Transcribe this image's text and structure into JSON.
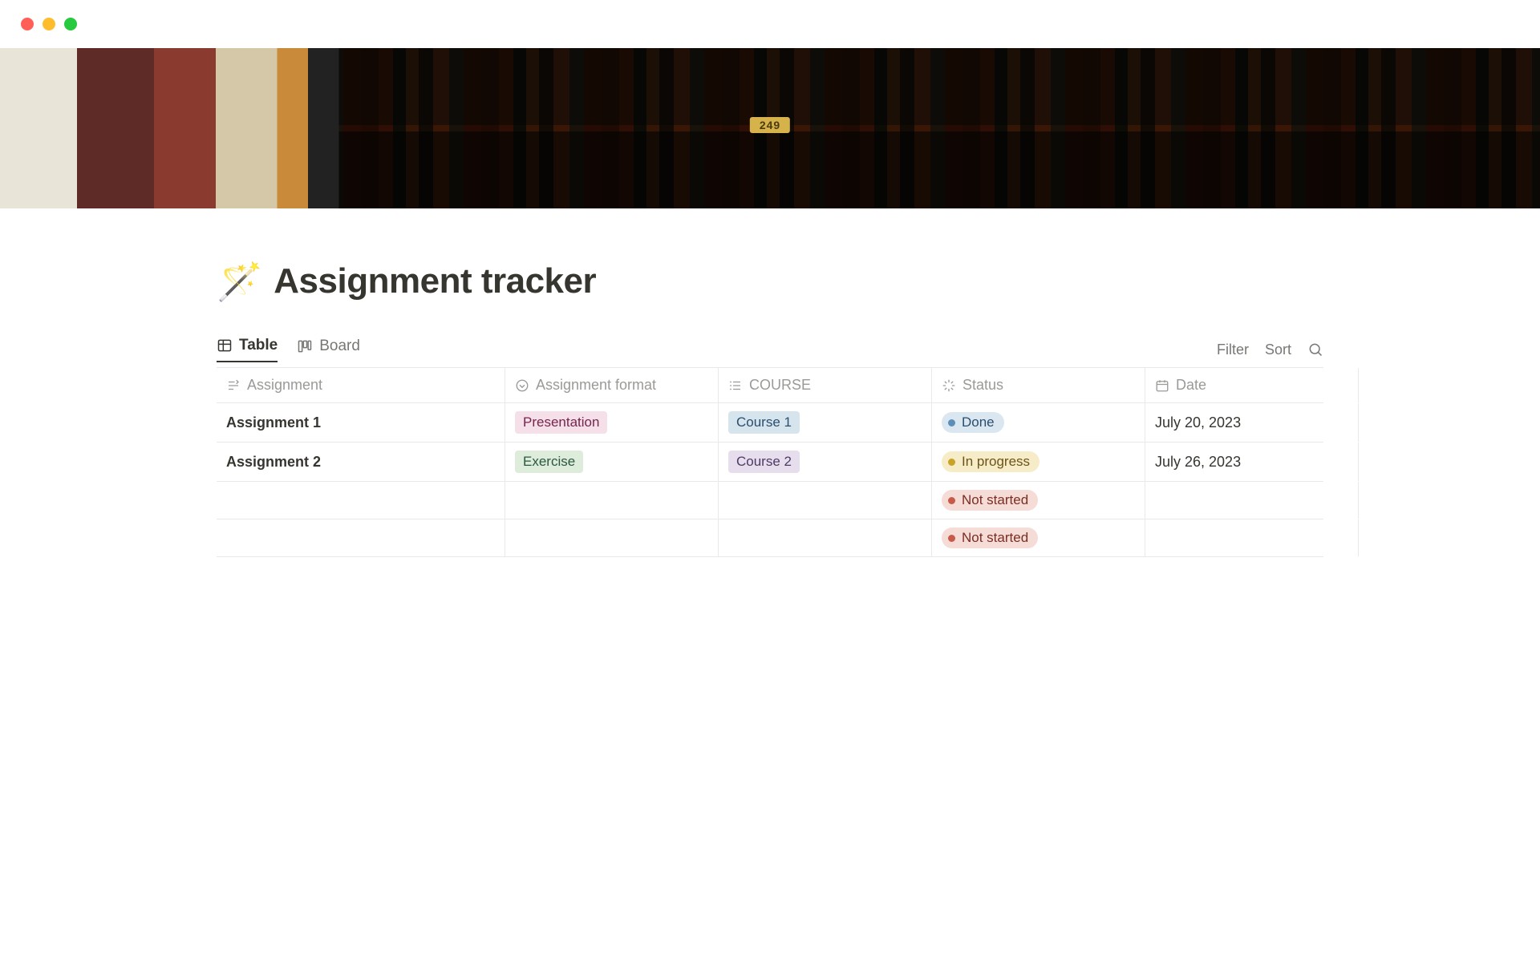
{
  "page": {
    "icon": "🪄",
    "title": "Assignment tracker"
  },
  "tabs": [
    {
      "id": "table",
      "label": "Table",
      "active": true
    },
    {
      "id": "board",
      "label": "Board",
      "active": false
    }
  ],
  "controls": {
    "filter": "Filter",
    "sort": "Sort"
  },
  "columns": [
    {
      "id": "assignment",
      "label": "Assignment",
      "icon": "text"
    },
    {
      "id": "format",
      "label": "Assignment format",
      "icon": "select"
    },
    {
      "id": "course",
      "label": "COURSE",
      "icon": "list"
    },
    {
      "id": "status",
      "label": "Status",
      "icon": "status"
    },
    {
      "id": "date",
      "label": "Date",
      "icon": "calendar"
    }
  ],
  "rows": [
    {
      "assignment": "Assignment 1",
      "format": {
        "label": "Presentation",
        "color": "pink"
      },
      "course": {
        "label": "Course 1",
        "color": "blue"
      },
      "status": {
        "label": "Done",
        "state": "done"
      },
      "date": "July 20, 2023"
    },
    {
      "assignment": "Assignment 2",
      "format": {
        "label": "Exercise",
        "color": "green"
      },
      "course": {
        "label": "Course 2",
        "color": "purple"
      },
      "status": {
        "label": "In progress",
        "state": "progress"
      },
      "date": "July 26, 2023"
    },
    {
      "assignment": "",
      "format": null,
      "course": null,
      "status": {
        "label": "Not started",
        "state": "notstarted"
      },
      "date": ""
    },
    {
      "assignment": "",
      "format": null,
      "course": null,
      "status": {
        "label": "Not started",
        "state": "notstarted"
      },
      "date": ""
    }
  ]
}
